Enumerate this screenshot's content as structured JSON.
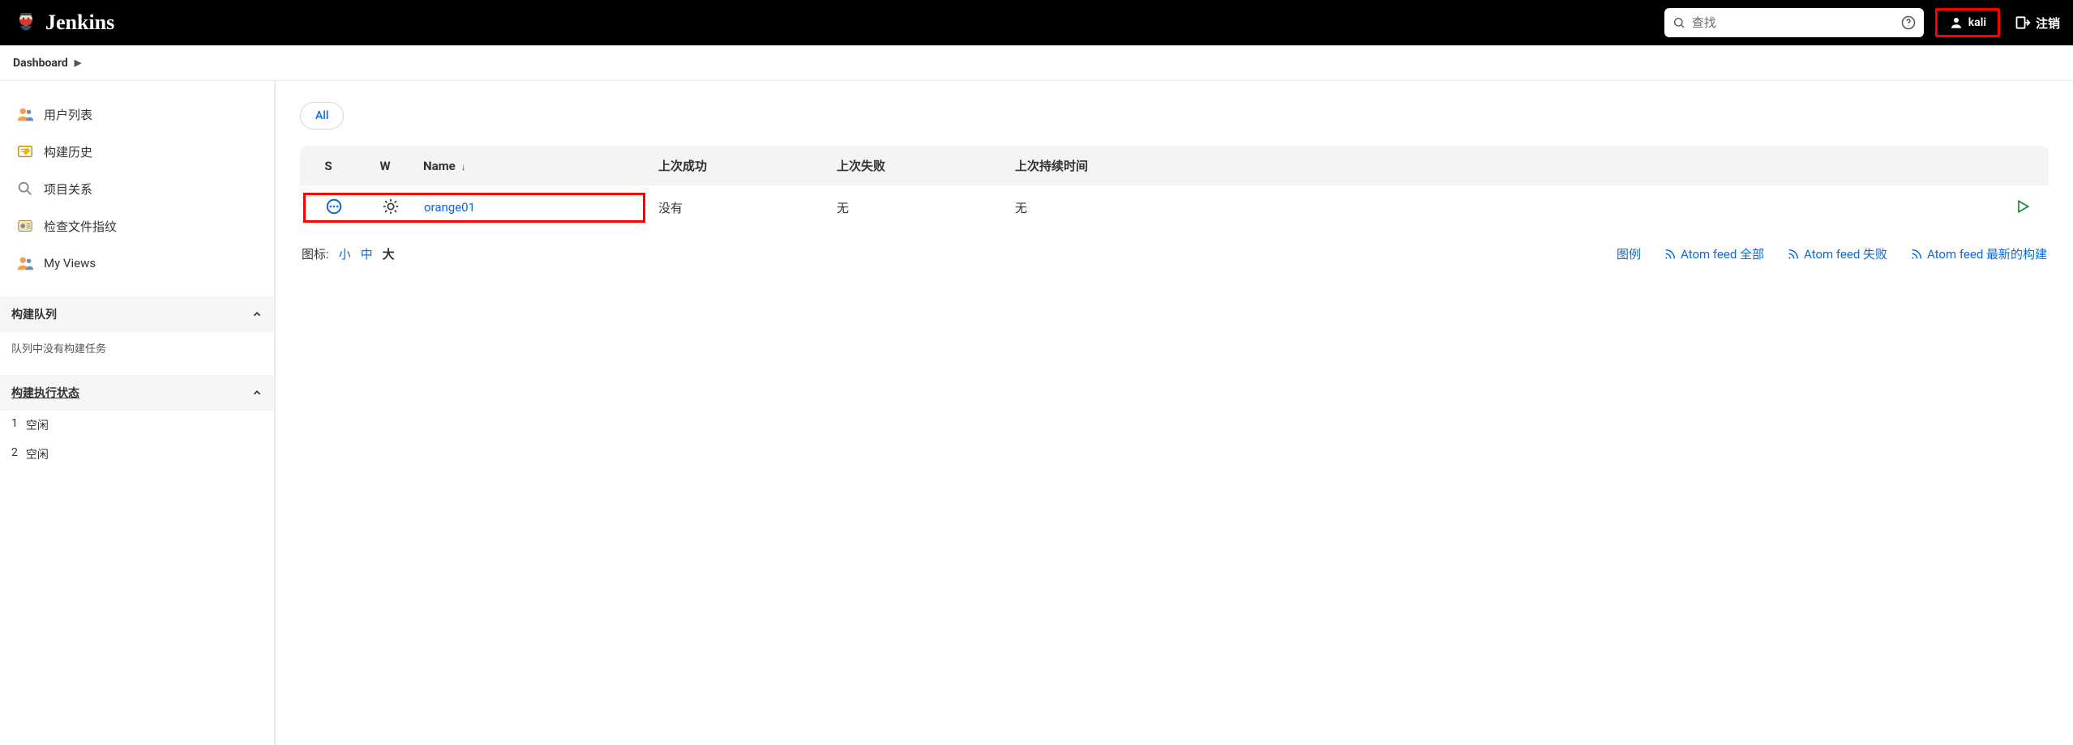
{
  "header": {
    "brand": "Jenkins",
    "search_placeholder": "查找",
    "user_label": "kali",
    "logout_label": "注销"
  },
  "breadcrumb": {
    "items": [
      "Dashboard"
    ]
  },
  "sidebar": {
    "nav": [
      {
        "label": "用户列表"
      },
      {
        "label": "构建历史"
      },
      {
        "label": "项目关系"
      },
      {
        "label": "检查文件指纹"
      },
      {
        "label": "My Views"
      }
    ],
    "build_queue": {
      "title": "构建队列",
      "empty_text": "队列中没有构建任务"
    },
    "executor_status": {
      "title": "构建执行状态",
      "executors": [
        {
          "num": "1",
          "state": "空闲"
        },
        {
          "num": "2",
          "state": "空闲"
        }
      ]
    }
  },
  "tabs": [
    "All"
  ],
  "jobs_table": {
    "headers": {
      "s": "S",
      "w": "W",
      "name": "Name",
      "last_success": "上次成功",
      "last_failure": "上次失败",
      "last_duration": "上次持续时间"
    },
    "rows": [
      {
        "name": "orange01",
        "last_success": "没有",
        "last_failure": "无",
        "last_duration": "无"
      }
    ]
  },
  "footer": {
    "icon_size_label": "图标:",
    "sizes": {
      "small": "小",
      "medium": "中",
      "large": "大"
    },
    "legend": "图例",
    "feeds": {
      "all": "Atom feed 全部",
      "failures": "Atom feed 失败",
      "latest": "Atom feed 最新的构建"
    }
  },
  "colors": {
    "link": "#0969da",
    "highlight": "#ff0000",
    "success": "#1a7f37"
  }
}
